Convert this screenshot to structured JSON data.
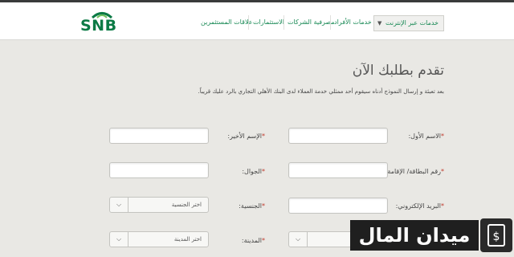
{
  "header": {
    "logo_text": "SNB",
    "nav": [
      {
        "label": "علاقات المستثمرين"
      },
      {
        "label": "الاستثمارات"
      },
      {
        "label": "مصرفية الشركات"
      },
      {
        "label": "خدمات الأفراد"
      }
    ],
    "online_services": {
      "label": "خدمات عبر الإنترنت"
    }
  },
  "form": {
    "title": "تقدم بطلبك الآن",
    "subtitle": "بعد تعبئة و إرسال النموذج أدناه سيقوم أحد ممثلي خدمة العملاء لدى البنك الأهلي التجاري بالرد عليك قريباً.",
    "required_mark": "*",
    "fields": {
      "first_name": {
        "label": "الاسم الأول:"
      },
      "last_name": {
        "label": "الإسم الأخير:"
      },
      "id_number": {
        "label": "رقم البطاقة/ الإقامة:"
      },
      "mobile": {
        "label": "الجوال:"
      },
      "email": {
        "label": "البريد الإلكتروني:"
      },
      "nationality": {
        "label": "الجنسية:",
        "value": "اختر الجنسية"
      },
      "city": {
        "label": "المدينة:",
        "value": "اختر المدينة"
      }
    }
  },
  "watermark": {
    "text": "ميدان المال"
  }
}
